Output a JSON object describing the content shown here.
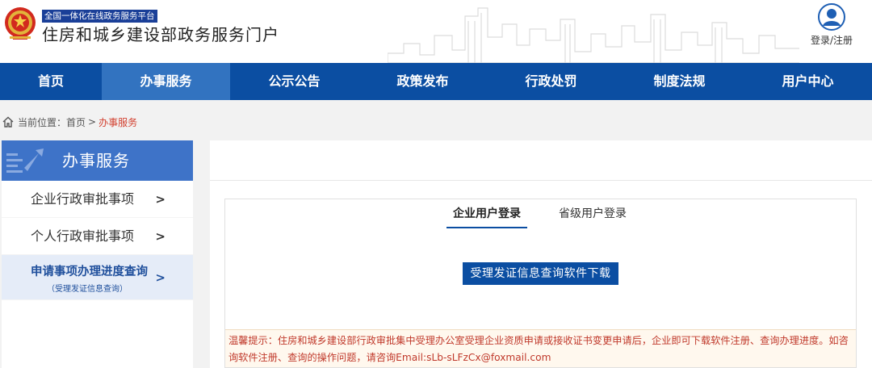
{
  "header": {
    "platform_tag": "全国一体化在线政务服务平台",
    "site_title": "住房和城乡建设部政务服务门户",
    "login_label": "登录/注册"
  },
  "nav": {
    "items": [
      "首页",
      "办事服务",
      "公示公告",
      "政策发布",
      "行政处罚",
      "制度法规",
      "用户中心"
    ],
    "active_index": 1
  },
  "breadcrumb": {
    "prefix": "当前位置：",
    "home": "首页",
    "separator": ">",
    "current": "办事服务"
  },
  "sidebar": {
    "title": "办事服务",
    "items": [
      {
        "label": "企业行政审批事项",
        "chevron": ">"
      },
      {
        "label": "个人行政审批事项",
        "chevron": ">"
      },
      {
        "label": "申请事项办理进度查询",
        "sublabel": "（受理发证信息查询）",
        "chevron": ">",
        "active": true
      }
    ]
  },
  "main": {
    "tabs": [
      "企业用户登录",
      "省级用户登录"
    ],
    "active_tab": 0,
    "download_button": "受理发证信息查询软件下载",
    "notice": "温馨提示：住房和城乡建设部行政审批集中受理办公室受理企业资质申请或接收证书变更申请后，企业即可下载软件注册、查询办理进度。如咨询软件注册、查询的操作问题，请咨询Email:sLb-sLFzCx@foxmail.com"
  },
  "colors": {
    "nav_bg": "#0b4ea2",
    "nav_active": "#3273c0",
    "sidebar_head": "#3e73c8",
    "notice_text": "#c0392b",
    "breadcrumb_current": "#d2402f"
  },
  "icons": [
    "national-emblem-icon",
    "user-avatar-icon",
    "home-icon",
    "sidebar-decoration-icon"
  ]
}
